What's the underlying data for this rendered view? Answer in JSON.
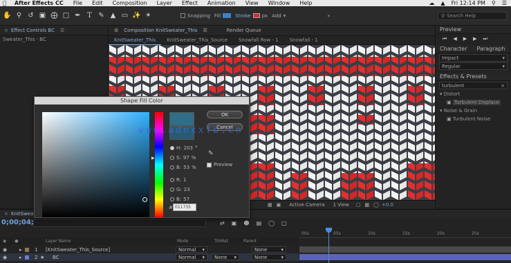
{
  "menubar": {
    "app": "After Effects CC",
    "items": [
      "File",
      "Edit",
      "Composition",
      "Layer",
      "Effect",
      "Animation",
      "View",
      "Window",
      "Help"
    ],
    "clock": "Fri 12:14 PM"
  },
  "toolbar": {
    "snapping": "Snapping",
    "fill": "Fill",
    "stroke": "Stroke",
    "stroke_width": "px",
    "add": "Add",
    "search_help": "Search Help"
  },
  "left_panel": {
    "tab": "Effect Controls BC",
    "layer": "Sweater_This · BC"
  },
  "comp": {
    "header_tab": "Composition KnitSweater_This",
    "render_queue": "Render Queue",
    "tabs": [
      "KnitSweater_This",
      "KnitSweater_This_Source",
      "Snowfall Row - 1",
      "Snowfall - 1"
    ],
    "active_tab": 0,
    "viewer_bar": {
      "view": "Active Camera",
      "views": "1 View",
      "offset": "+0.0"
    }
  },
  "right_panel": {
    "preview_title": "Preview",
    "character_tab": "Character",
    "paragraph_tab": "Paragraph",
    "font": "Impact",
    "style": "Regular",
    "effects_title": "Effects & Presets",
    "search_value": "turbulent",
    "groups": [
      {
        "name": "Distort",
        "items": [
          "Turbulent Displace"
        ]
      },
      {
        "name": "Noise & Grain",
        "items": [
          "Turbulent Noise"
        ]
      }
    ]
  },
  "dialog": {
    "title": "Shape Fill Color",
    "ok": "OK",
    "cancel": "Cancel",
    "fields": [
      {
        "label": "H:",
        "value": "203",
        "unit": "°",
        "selected": true
      },
      {
        "label": "S:",
        "value": "97",
        "unit": "%",
        "selected": false
      },
      {
        "label": "B:",
        "value": "53",
        "unit": "%",
        "selected": false
      },
      {
        "label": "R:",
        "value": "1",
        "unit": "",
        "selected": false
      },
      {
        "label": "G:",
        "value": "23",
        "unit": "",
        "selected": false
      },
      {
        "label": "B:",
        "value": "57",
        "unit": "",
        "selected": false
      }
    ],
    "hex_prefix": "#",
    "hex": "011735",
    "preview_label": "Preview"
  },
  "watermark": "www.adnxxfb.cn",
  "timeline": {
    "tab": "KnitSweater_This",
    "timecode": "0;00;04;03",
    "columns": {
      "layer_name": "Layer Name",
      "mode": "Mode",
      "trkmat": "TrkMat",
      "parent": "Parent"
    },
    "ruler_ticks": [
      "00s",
      "05s",
      "10s",
      "15s",
      "20s",
      "25s"
    ],
    "layers": [
      {
        "num": "1",
        "name": "[KnitSweater_This_Source]",
        "mode": "Normal",
        "trkmat": "",
        "parent": "None"
      },
      {
        "num": "2",
        "name": "BC",
        "mode": "Normal",
        "trkmat": "None",
        "parent": "None"
      }
    ]
  }
}
